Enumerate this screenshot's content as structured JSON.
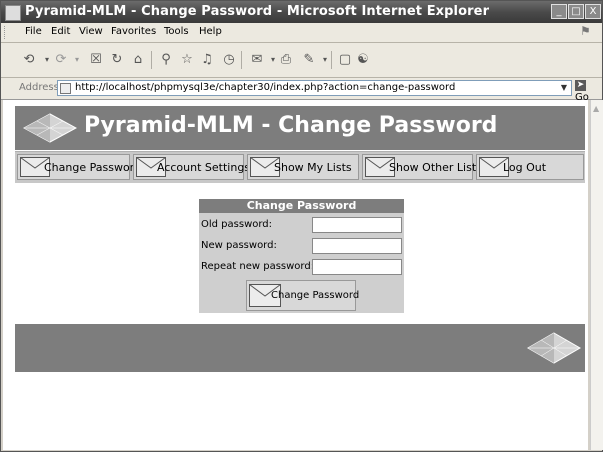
{
  "window": {
    "title": "Pyramid-MLM - Change Password - Microsoft Internet Explorer",
    "buttons": {
      "minimize": "_",
      "maximize": "□",
      "close": "X"
    }
  },
  "menu": {
    "items": [
      "File",
      "Edit",
      "View",
      "Favorites",
      "Tools",
      "Help"
    ]
  },
  "toolbar": {
    "icons": [
      "back-icon",
      "forward-icon",
      "stop-icon",
      "refresh-icon",
      "home-icon",
      "search-icon",
      "favorites-icon",
      "media-icon",
      "history-icon",
      "mail-icon",
      "print-icon",
      "edit-icon",
      "discuss-icon",
      "messenger-icon"
    ]
  },
  "address": {
    "label": "Address",
    "url": "http://localhost/phpmysql3e/chapter30/index.php?action=change-password",
    "go_label": "Go"
  },
  "page": {
    "title": "Pyramid-MLM - Change Password",
    "nav": [
      "Change Password",
      "Account Settings",
      "Show My Lists",
      "Show Other Lists",
      "Log Out"
    ],
    "form": {
      "header": "Change Password",
      "old_label": "Old password:",
      "new_label": "New password:",
      "repeat_label": "Repeat new password:",
      "old_value": "",
      "new_value": "",
      "repeat_value": "",
      "submit_label": "Change Password"
    }
  },
  "colors": {
    "band": "#7d7d7d",
    "nav_bg": "#c8c8c8",
    "form_bg": "#cfcfcf",
    "title_text": "#ffffff"
  }
}
